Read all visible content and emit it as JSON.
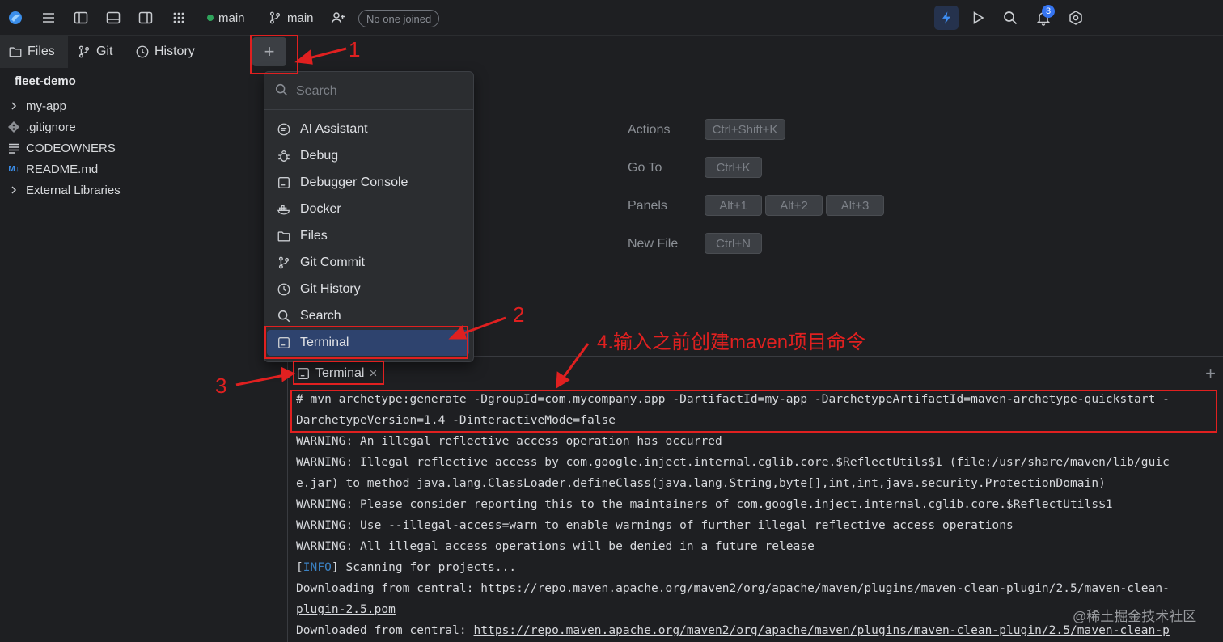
{
  "topbar": {
    "branch_dot_label": "main",
    "git_branch_label": "main",
    "collab_status": "No one joined",
    "notification_count": "3",
    "colors": {
      "accent": "#3574f0",
      "run_bg": "#25324d",
      "branch_dot": "#2fa35b"
    },
    "icons": [
      "app-logo-icon",
      "hamburger-menu-icon",
      "left-panel-icon",
      "bottom-panel-icon",
      "right-panel-icon",
      "apps-grid-icon",
      "git-branch-icon",
      "add-user-icon",
      "lightning-icon",
      "run-icon",
      "search-icon",
      "bell-icon",
      "settings-icon"
    ]
  },
  "left_tabs": {
    "files": "Files",
    "git": "Git",
    "history": "History",
    "add_symbol": "+"
  },
  "tree": {
    "project": "fleet-demo",
    "items": [
      {
        "label": "my-app",
        "icon": "chevron-right-icon"
      },
      {
        "label": ".gitignore",
        "icon": "git-file-icon"
      },
      {
        "label": "CODEOWNERS",
        "icon": "text-lines-icon"
      },
      {
        "label": "README.md",
        "icon": "markdown-icon"
      },
      {
        "label": "External Libraries",
        "icon": "chevron-right-icon"
      }
    ]
  },
  "dropdown": {
    "search_placeholder": "Search",
    "items": [
      {
        "label": "AI Assistant",
        "icon": "chat-icon"
      },
      {
        "label": "Debug",
        "icon": "bug-icon"
      },
      {
        "label": "Debugger Console",
        "icon": "console-icon"
      },
      {
        "label": "Docker",
        "icon": "docker-icon"
      },
      {
        "label": "Files",
        "icon": "folder-icon"
      },
      {
        "label": "Git Commit",
        "icon": "git-branch-icon"
      },
      {
        "label": "Git History",
        "icon": "clock-icon"
      },
      {
        "label": "Search",
        "icon": "search-icon"
      },
      {
        "label": "Terminal",
        "icon": "terminal-icon",
        "selected": true
      }
    ]
  },
  "shortcuts": {
    "actions_label": "Actions",
    "actions_key": "Ctrl+Shift+K",
    "goto_label": "Go To",
    "goto_key": "Ctrl+K",
    "panels_label": "Panels",
    "panels_keys": [
      "Alt+1",
      "Alt+2",
      "Alt+3"
    ],
    "newfile_label": "New File",
    "newfile_key": "Ctrl+N"
  },
  "terminal": {
    "tab_label": "Terminal",
    "close_symbol": "×",
    "add_symbol": "+",
    "lines": [
      "# mvn archetype:generate -DgroupId=com.mycompany.app -DartifactId=my-app -DarchetypeArtifactId=maven-archetype-quickstart -",
      "DarchetypeVersion=1.4 -DinteractiveMode=false",
      "WARNING: An illegal reflective access operation has occurred",
      "WARNING: Illegal reflective access by com.google.inject.internal.cglib.core.$ReflectUtils$1 (file:/usr/share/maven/lib/guic",
      "e.jar) to method java.lang.ClassLoader.defineClass(java.lang.String,byte[],int,int,java.security.ProtectionDomain)",
      "WARNING: Please consider reporting this to the maintainers of com.google.inject.internal.cglib.core.$ReflectUtils$1",
      "WARNING: Use --illegal-access=warn to enable warnings of further illegal reflective access operations",
      "WARNING: All illegal access operations will be denied in a future release"
    ],
    "info_prefix": "[",
    "info_tag": "INFO",
    "info_rest": "] Scanning for projects...",
    "download1_prefix": "Downloading from central: ",
    "download1_url": "https://repo.maven.apache.org/maven2/org/apache/maven/plugins/maven-clean-plugin/2.5/maven-clean-",
    "download1_cont": "plugin-2.5.pom",
    "download2_prefix": "Downloaded from central: ",
    "download2_url": "https://repo.maven.apache.org/maven2/org/apache/maven/plugins/maven-clean-plugin/2.5/maven-clean-p"
  },
  "annotations": {
    "n1": "1",
    "n2": "2",
    "n3": "3",
    "n4": "4.输入之前创建maven项目命令",
    "color": "#e02020"
  },
  "watermark": "@稀土掘金技术社区"
}
